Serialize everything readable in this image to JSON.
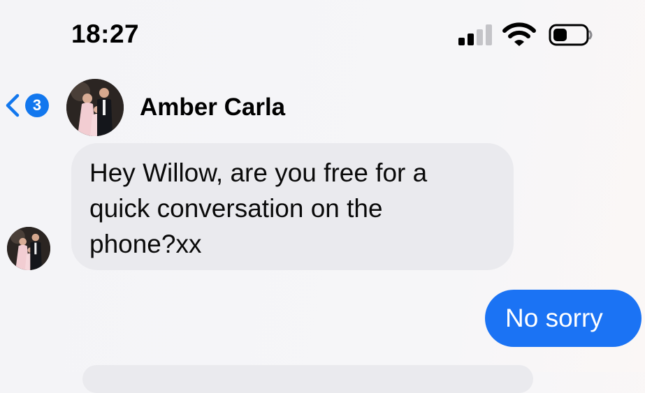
{
  "status_bar": {
    "time": "18:27",
    "signal_icon": "cellular-signal-icon",
    "signal_bars_active": 2,
    "signal_bars_total": 4,
    "wifi_icon": "wifi-icon",
    "battery_icon": "battery-icon",
    "battery_level": 0.3
  },
  "header": {
    "back_icon": "chevron-left-icon",
    "unread_count": "3",
    "contact_name": "Amber Carla",
    "avatar": "contact-avatar-photo"
  },
  "messages": [
    {
      "direction": "incoming",
      "text": "Hey Willow, are you free for a\nquick conversation on the\nphone?xx"
    },
    {
      "direction": "outgoing",
      "text": "No sorry"
    }
  ],
  "colors": {
    "accent": "#1b73f4",
    "badge": "#1277ee",
    "incoming_bubble": "#eaeaee",
    "background": "#f4f4f7"
  }
}
